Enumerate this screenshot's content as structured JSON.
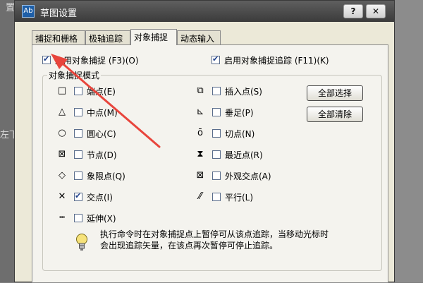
{
  "background": {
    "text_top": "置",
    "text_left": "左下方"
  },
  "window": {
    "title": "草图设置",
    "app_icon_text": "Ab",
    "help_button": "?",
    "close_button": "✕"
  },
  "tabs": [
    "捕捉和栅格",
    "极轴追踪",
    "对象捕捉",
    "动态输入"
  ],
  "snap_enable": {
    "label": "启用对象捕捉 (F3)(O)",
    "checked": true
  },
  "snap_tracking": {
    "label": "启用对象捕捉追踪 (F11)(K)",
    "checked": true
  },
  "group_title": "对象捕捉模式",
  "left_modes": [
    {
      "symbol": "□",
      "label": "端点(E)",
      "checked": false
    },
    {
      "symbol": "△",
      "label": "中点(M)",
      "checked": false
    },
    {
      "symbol": "○",
      "label": "圆心(C)",
      "checked": false
    },
    {
      "symbol": "⊠",
      "label": "节点(D)",
      "checked": false
    },
    {
      "symbol": "◇",
      "label": "象限点(Q)",
      "checked": false
    },
    {
      "symbol": "✕",
      "label": "交点(I)",
      "checked": true
    },
    {
      "symbol": "┅",
      "label": "延伸(X)",
      "checked": false
    }
  ],
  "right_modes": [
    {
      "symbol": "⧉",
      "label": "插入点(S)",
      "checked": false
    },
    {
      "symbol": "⊾",
      "label": "垂足(P)",
      "checked": false
    },
    {
      "symbol": "ō",
      "label": "切点(N)",
      "checked": false
    },
    {
      "symbol": "⧗",
      "label": "最近点(R)",
      "checked": false
    },
    {
      "symbol": "⊠",
      "label": "外观交点(A)",
      "checked": false
    },
    {
      "symbol": "⁄⁄",
      "label": "平行(L)",
      "checked": false
    }
  ],
  "buttons": {
    "select_all": "全部选择",
    "clear_all": "全部清除"
  },
  "note_line1": "执行命令时在对象捕捉点上暂停可从该点追踪，当移动光标时",
  "note_line2": "会出现追踪矢量，在该点再次暂停可停止追踪。",
  "colors": {
    "arrow": "#e8453c",
    "titlebar": "#4a4a4a"
  }
}
